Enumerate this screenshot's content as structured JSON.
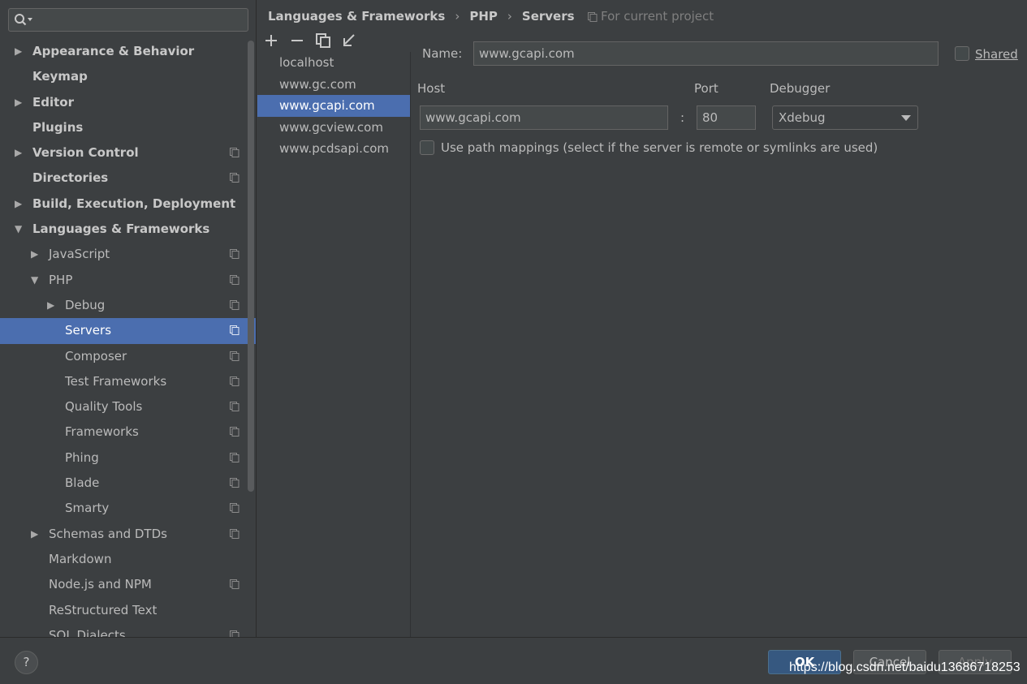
{
  "search": {
    "value": "",
    "placeholder": ""
  },
  "tree": [
    {
      "label": "Appearance & Behavior",
      "level": 0,
      "arrow": "right",
      "bold": true,
      "project": false
    },
    {
      "label": "Keymap",
      "level": 0,
      "arrow": "",
      "bold": true,
      "project": false
    },
    {
      "label": "Editor",
      "level": 0,
      "arrow": "right",
      "bold": true,
      "project": false
    },
    {
      "label": "Plugins",
      "level": 0,
      "arrow": "",
      "bold": true,
      "project": false
    },
    {
      "label": "Version Control",
      "level": 0,
      "arrow": "right",
      "bold": true,
      "project": true
    },
    {
      "label": "Directories",
      "level": 0,
      "arrow": "",
      "bold": true,
      "project": true
    },
    {
      "label": "Build, Execution, Deployment",
      "level": 0,
      "arrow": "right",
      "bold": true,
      "project": false
    },
    {
      "label": "Languages & Frameworks",
      "level": 0,
      "arrow": "down",
      "bold": true,
      "project": false
    },
    {
      "label": "JavaScript",
      "level": 1,
      "arrow": "right",
      "bold": false,
      "project": true
    },
    {
      "label": "PHP",
      "level": 1,
      "arrow": "down",
      "bold": false,
      "project": true
    },
    {
      "label": "Debug",
      "level": 2,
      "arrow": "right",
      "bold": false,
      "project": true
    },
    {
      "label": "Servers",
      "level": 2,
      "arrow": "",
      "bold": false,
      "project": true,
      "selected": true
    },
    {
      "label": "Composer",
      "level": 2,
      "arrow": "",
      "bold": false,
      "project": true
    },
    {
      "label": "Test Frameworks",
      "level": 2,
      "arrow": "",
      "bold": false,
      "project": true
    },
    {
      "label": "Quality Tools",
      "level": 2,
      "arrow": "",
      "bold": false,
      "project": true
    },
    {
      "label": "Frameworks",
      "level": 2,
      "arrow": "",
      "bold": false,
      "project": true
    },
    {
      "label": "Phing",
      "level": 2,
      "arrow": "",
      "bold": false,
      "project": true
    },
    {
      "label": "Blade",
      "level": 2,
      "arrow": "",
      "bold": false,
      "project": true
    },
    {
      "label": "Smarty",
      "level": 2,
      "arrow": "",
      "bold": false,
      "project": true
    },
    {
      "label": "Schemas and DTDs",
      "level": 1,
      "arrow": "right",
      "bold": false,
      "project": true
    },
    {
      "label": "Markdown",
      "level": 1,
      "arrow": "",
      "bold": false,
      "project": false
    },
    {
      "label": "Node.js and NPM",
      "level": 1,
      "arrow": "",
      "bold": false,
      "project": true
    },
    {
      "label": "ReStructured Text",
      "level": 1,
      "arrow": "",
      "bold": false,
      "project": false
    },
    {
      "label": "SQL Dialects",
      "level": 1,
      "arrow": "",
      "bold": false,
      "project": true
    }
  ],
  "breadcrumb": {
    "parts": [
      "Languages & Frameworks",
      "PHP",
      "Servers"
    ],
    "separator": "›",
    "scope": "For current project"
  },
  "servers": {
    "items": [
      "localhost",
      "www.gc.com",
      "www.gcapi.com",
      "www.gcview.com",
      "www.pcdsapi.com"
    ],
    "selected_index": 2
  },
  "detail": {
    "name_label": "Name:",
    "name_value": "www.gcapi.com",
    "shared_label": "Shared",
    "host_label": "Host",
    "host_value": "www.gcapi.com",
    "colon": ":",
    "port_label": "Port",
    "port_value": "80",
    "debugger_label": "Debugger",
    "debugger_value": "Xdebug",
    "path_mappings_label": "Use path mappings (select if the server is remote or symlinks are used)"
  },
  "footer": {
    "help": "?",
    "ok": "OK",
    "cancel": "Cancel",
    "apply": "Apply",
    "watermark": "https://blog.csdn.net/baidu13686718253"
  },
  "colors": {
    "background": "#3c3f41",
    "selection": "#4b6eaf",
    "text": "#bbbbbb",
    "ok_button": "#365880"
  }
}
